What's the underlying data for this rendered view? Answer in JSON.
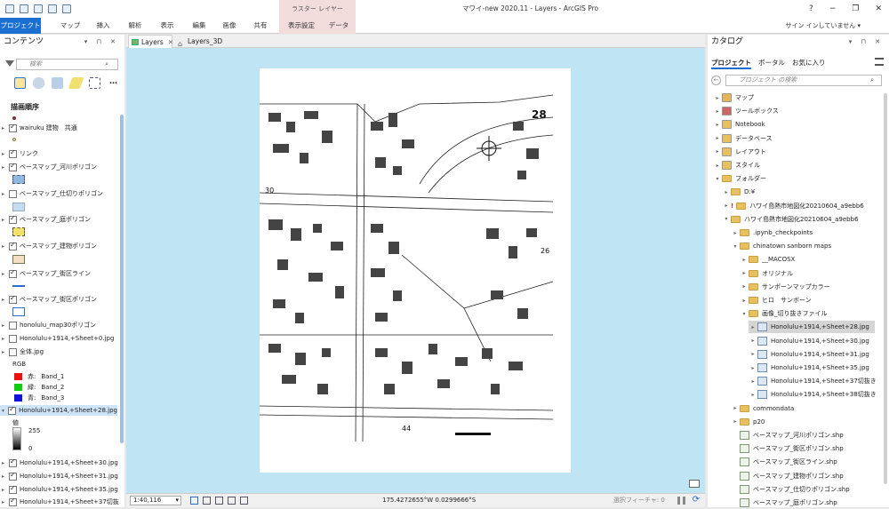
{
  "window": {
    "title": "マワイ-new 2020.11 - Layers - ArcGIS Pro",
    "context_group": "ラスター レイヤー",
    "help": "?",
    "minimize": "−",
    "restore": "❐",
    "close": "✕"
  },
  "ribbon": {
    "tabs": [
      "プロジェクト",
      "マップ",
      "挿入",
      "解析",
      "表示",
      "編集",
      "画像",
      "共有",
      "表示設定",
      "データ"
    ],
    "signin": "サイン インしていません ▾"
  },
  "contents": {
    "title": "コンテンツ",
    "search_placeholder": "検索",
    "draw_order": "描画順序",
    "layers": [
      {
        "label": "wairuku 建物　共通",
        "checked": true
      },
      {
        "label": "リンク",
        "checked": true
      },
      {
        "label": "ベースマップ_河川ポリゴン",
        "checked": true
      },
      {
        "label": "ベースマップ_仕切りポリゴン",
        "checked": false
      },
      {
        "label": "ベースマップ_庭ポリゴン",
        "checked": true
      },
      {
        "label": "ベースマップ_建物ポリゴン",
        "checked": true
      },
      {
        "label": "ベースマップ_街区ライン",
        "checked": true
      },
      {
        "label": "ベースマップ_街区ポリゴン",
        "checked": true
      },
      {
        "label": "honolulu_map30ポリゴン",
        "checked": false
      },
      {
        "label": "Honolulu+1914,+Sheet+0.jpg",
        "checked": false
      },
      {
        "label": "全体.jpg",
        "checked": false
      }
    ],
    "rgb": {
      "title": "RGB",
      "bands": [
        {
          "ch": "赤:",
          "band": "Band_1",
          "color": "#e11"
        },
        {
          "ch": "緑:",
          "band": "Band_2",
          "color": "#1c1"
        },
        {
          "ch": "青:",
          "band": "Band_3",
          "color": "#11d"
        }
      ]
    },
    "selected_layer": "Honolulu+1914,+Sheet+28.jpg",
    "value_label": "値",
    "ramp_max": "255",
    "ramp_min": "0",
    "more_layers": [
      "Honolulu+1914,+Sheet+30.jpg",
      "Honolulu+1914,+Sheet+31.jpg",
      "Honolulu+1914,+Sheet+35.jpg",
      "Honolulu+1914,+Sheet+37切抜"
    ]
  },
  "map": {
    "tabs": [
      {
        "label": "Layers",
        "active": true
      },
      {
        "label": "Layers_3D",
        "active": false
      }
    ],
    "sheet_number": "28",
    "scale": "1:40,116",
    "coordinates": "175.4272655°W 0.0299666°S",
    "selected_features": "選択フィーチャ: 0",
    "labels": {
      "left": "30",
      "right": "26",
      "bottom": "44"
    }
  },
  "catalog": {
    "title": "カタログ",
    "tabs": [
      "プロジェクト",
      "ポータル",
      "お気に入り"
    ],
    "search_placeholder": "プロジェクト の検索",
    "items": [
      {
        "label": "マップ",
        "indent": 0,
        "type": "gen",
        "color": "#e8b45a"
      },
      {
        "label": "ツールボックス",
        "indent": 0,
        "type": "gen",
        "color": "#c66"
      },
      {
        "label": "Notebook",
        "indent": 0,
        "type": "gen",
        "color": "#e8c060"
      },
      {
        "label": "データベース",
        "indent": 0,
        "type": "gen",
        "color": "#e8c060"
      },
      {
        "label": "レイアウト",
        "indent": 0,
        "type": "gen",
        "color": "#e8c060"
      },
      {
        "label": "スタイル",
        "indent": 0,
        "type": "gen",
        "color": "#e8c060"
      },
      {
        "label": "フォルダー",
        "indent": 0,
        "type": "fold",
        "open": true
      },
      {
        "label": "D:¥",
        "indent": 1,
        "type": "fold"
      },
      {
        "label": "ハワイ島熱市地図化20210604_a9ebb6",
        "indent": 1,
        "type": "fold",
        "warn": true
      },
      {
        "label": "ハワイ島熱市地図化20210604_a9ebb6",
        "indent": 1,
        "type": "fold",
        "open": true
      },
      {
        "label": ".ipynb_checkpoints",
        "indent": 2,
        "type": "fold"
      },
      {
        "label": "chinatown sanborn maps",
        "indent": 2,
        "type": "fold",
        "open": true
      },
      {
        "label": "__MACOSX",
        "indent": 3,
        "type": "fold"
      },
      {
        "label": "オリジナル",
        "indent": 3,
        "type": "fold"
      },
      {
        "label": "サンボーンマップカラー",
        "indent": 3,
        "type": "fold"
      },
      {
        "label": "ヒロ　サンボーン",
        "indent": 3,
        "type": "fold"
      },
      {
        "label": "画像_切り抜きファイル",
        "indent": 3,
        "type": "fold",
        "open": true
      },
      {
        "label": "Honolulu+1914,+Sheet+28.jpg",
        "indent": 4,
        "type": "file",
        "selected": true
      },
      {
        "label": "Honolulu+1914,+Sheet+30.jpg",
        "indent": 4,
        "type": "file"
      },
      {
        "label": "Honolulu+1914,+Sheet+31.jpg",
        "indent": 4,
        "type": "file"
      },
      {
        "label": "Honolulu+1914,+Sheet+35.jpg",
        "indent": 4,
        "type": "file"
      },
      {
        "label": "Honolulu+1914,+Sheet+37切抜き",
        "indent": 4,
        "type": "file"
      },
      {
        "label": "Honolulu+1914,+Sheet+38切抜き",
        "indent": 4,
        "type": "file"
      },
      {
        "label": "commondata",
        "indent": 2,
        "type": "fold"
      },
      {
        "label": "p20",
        "indent": 2,
        "type": "fold"
      },
      {
        "label": "ベースマップ_河川ポリゴン.shp",
        "indent": 2,
        "type": "shp"
      },
      {
        "label": "ベースマップ_街区ポリゴン.shp",
        "indent": 2,
        "type": "shp"
      },
      {
        "label": "ベースマップ_街区ライン.shp",
        "indent": 2,
        "type": "shp"
      },
      {
        "label": "ベースマップ_建物ポリゴン.shp",
        "indent": 2,
        "type": "shp"
      },
      {
        "label": "ベースマップ_仕切りポリゴン.shp",
        "indent": 2,
        "type": "shp"
      },
      {
        "label": "ベースマップ_庭ポリゴン.shp",
        "indent": 2,
        "type": "shp"
      }
    ]
  }
}
